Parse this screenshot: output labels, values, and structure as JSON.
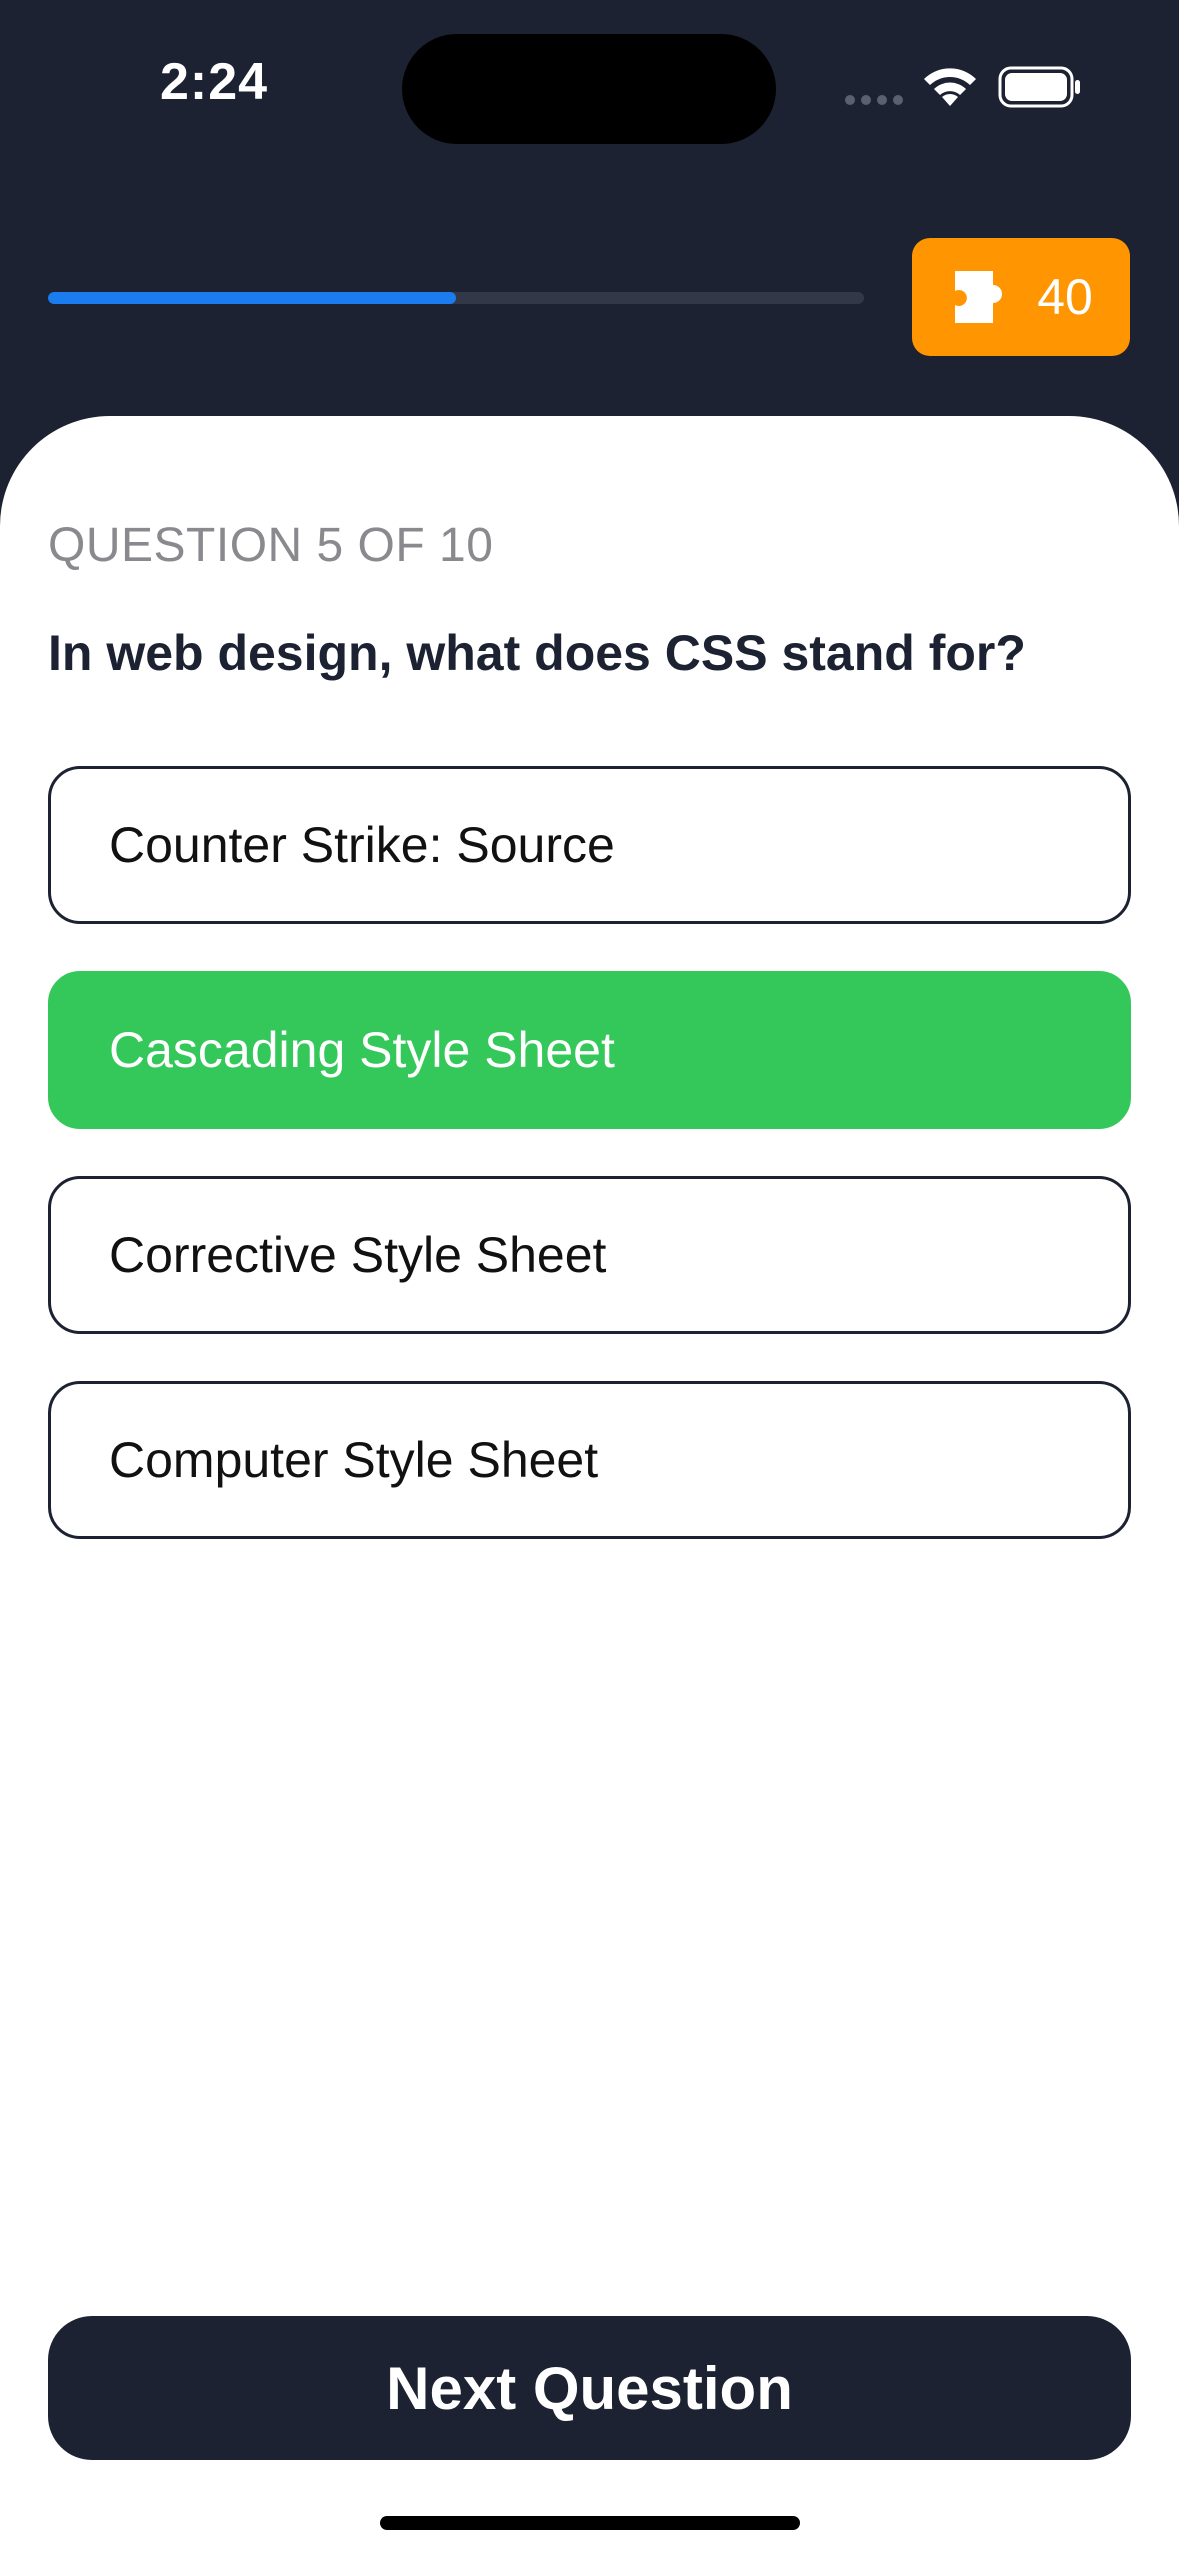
{
  "status_bar": {
    "time": "2:24"
  },
  "progress": {
    "fraction": 0.5,
    "track_color": "#323848",
    "fill_color": "#1b7cf0"
  },
  "score": {
    "icon": "puzzle-piece-icon",
    "value": "40",
    "color": "#ff9500"
  },
  "question": {
    "counter": "QUESTION 5 OF 10",
    "text": "In web design, what does CSS stand for?"
  },
  "answers": [
    {
      "label": "Counter Strike: Source",
      "selected": false
    },
    {
      "label": "Cascading Style Sheet",
      "selected": true
    },
    {
      "label": "Corrective Style Sheet",
      "selected": false
    },
    {
      "label": "Computer Style Sheet",
      "selected": false
    }
  ],
  "selected_color": "#34c85a",
  "next_button": {
    "label": "Next Question"
  }
}
